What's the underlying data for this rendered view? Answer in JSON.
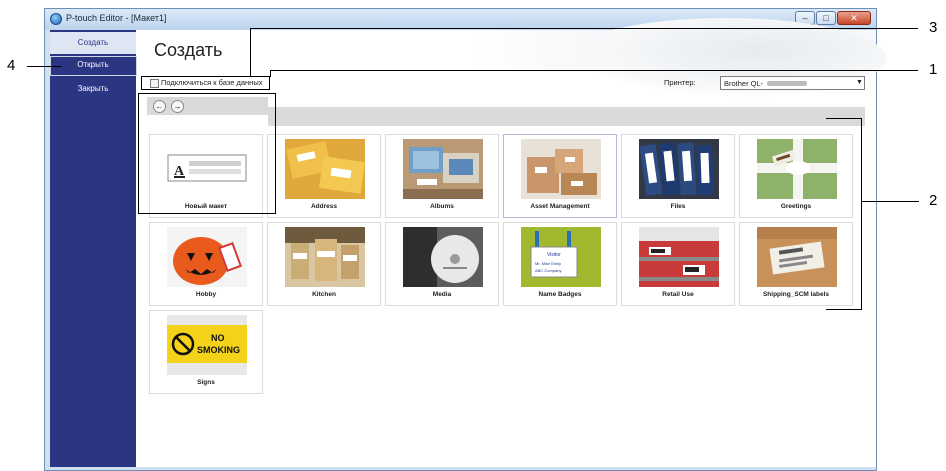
{
  "window": {
    "title": "P-touch Editor - [Макет1]",
    "controls": {
      "minimize": "–",
      "maximize": "□",
      "close": "✕"
    }
  },
  "sidebar": {
    "items": [
      {
        "label": "Создать",
        "selected": true
      },
      {
        "label": "Открыть",
        "selected": false
      },
      {
        "label": "Закрыть",
        "selected": false
      }
    ]
  },
  "main": {
    "title": "Создать",
    "db_checkbox_label": "Подключиться к базе данных",
    "db_checked": false,
    "printer_label": "Принтер:",
    "printer_value": "Brother QL-",
    "nav": {
      "back": "←",
      "forward": "→"
    }
  },
  "templates": [
    {
      "label": "Новый макет"
    },
    {
      "label": "Address"
    },
    {
      "label": "Albums"
    },
    {
      "label": "Asset Management"
    },
    {
      "label": "Files"
    },
    {
      "label": "Greetings"
    },
    {
      "label": "Hobby"
    },
    {
      "label": "Kitchen"
    },
    {
      "label": "Media"
    },
    {
      "label": "Name Badges"
    },
    {
      "label": "Retail Use"
    },
    {
      "label": "Shipping_SCM labels"
    },
    {
      "label": "Signs"
    }
  ],
  "thumb_text": {
    "new_layout_letter": "A",
    "signs_line1": "NO",
    "signs_line2": "SMOKING",
    "badge_line1": "Visitor",
    "badge_line2": "Mr. Mike Emily",
    "badge_line3": "ABC Company"
  },
  "callouts": [
    "1",
    "2",
    "3",
    "4"
  ],
  "colors": {
    "sidebar": "#2b3582",
    "accent_frame": "#000000"
  }
}
